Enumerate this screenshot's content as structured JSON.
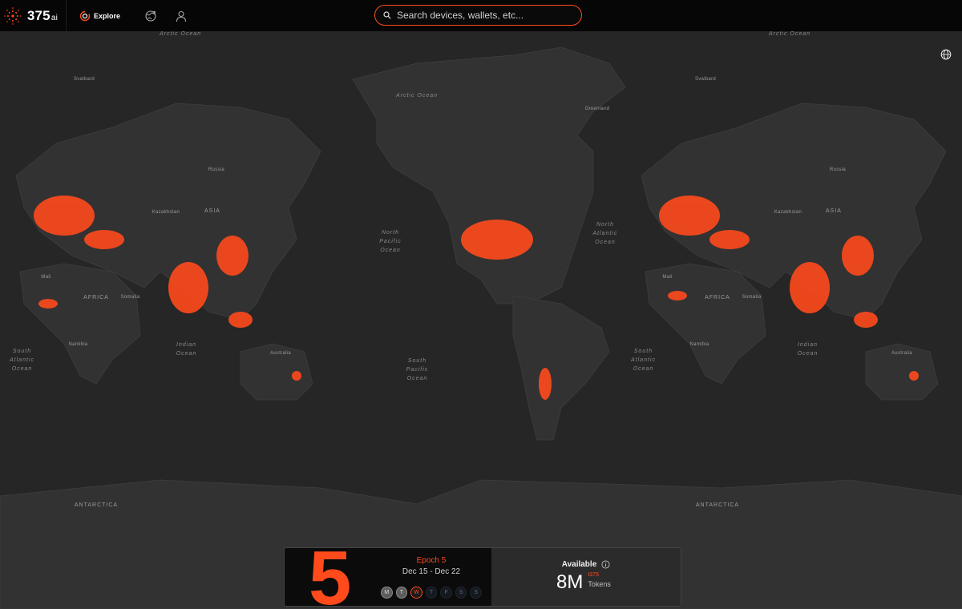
{
  "app": {
    "logo_text": "375",
    "logo_suffix": "ai"
  },
  "nav": {
    "explore_label": "Explore",
    "icons": [
      "explore-ring-icon",
      "globe-network-icon",
      "user-icon"
    ]
  },
  "search": {
    "placeholder": "Search devices, wallets, etc..."
  },
  "map": {
    "accent": "#ff4a1c",
    "labels": {
      "arctic_ocean": "Arctic Ocean",
      "north_pacific": "North Pacific Ocean",
      "north_atlantic": "North Atlantic Ocean",
      "south_atlantic": "South Atlantic Ocean",
      "south_pacific": "South Pacific Ocean",
      "indian_ocean": "Indian Ocean",
      "antarctica": "ANTARCTICA",
      "asia": "ASIA",
      "africa": "AFRICA",
      "svalbard": "Svalbard",
      "greenland": "Greenland",
      "russia": "Russia",
      "kazakhstan": "Kazakhstan",
      "mali": "Mali",
      "somalia": "Somalia",
      "namibia": "Namibia",
      "australia": "Australia",
      "arctic_top": "Arctic Ocean"
    }
  },
  "epoch": {
    "number": "5",
    "title": "Epoch 5",
    "dates": "Dec 15 - Dec 22",
    "days": [
      {
        "label": "M",
        "state": "done"
      },
      {
        "label": "T",
        "state": "done"
      },
      {
        "label": "W",
        "state": "current"
      },
      {
        "label": "T",
        "state": "future"
      },
      {
        "label": "F",
        "state": "future"
      },
      {
        "label": "S",
        "state": "future"
      },
      {
        "label": "S",
        "state": "future"
      }
    ]
  },
  "available": {
    "label": "Available",
    "value": "8M",
    "currency": "t375",
    "unit": "Tokens"
  }
}
